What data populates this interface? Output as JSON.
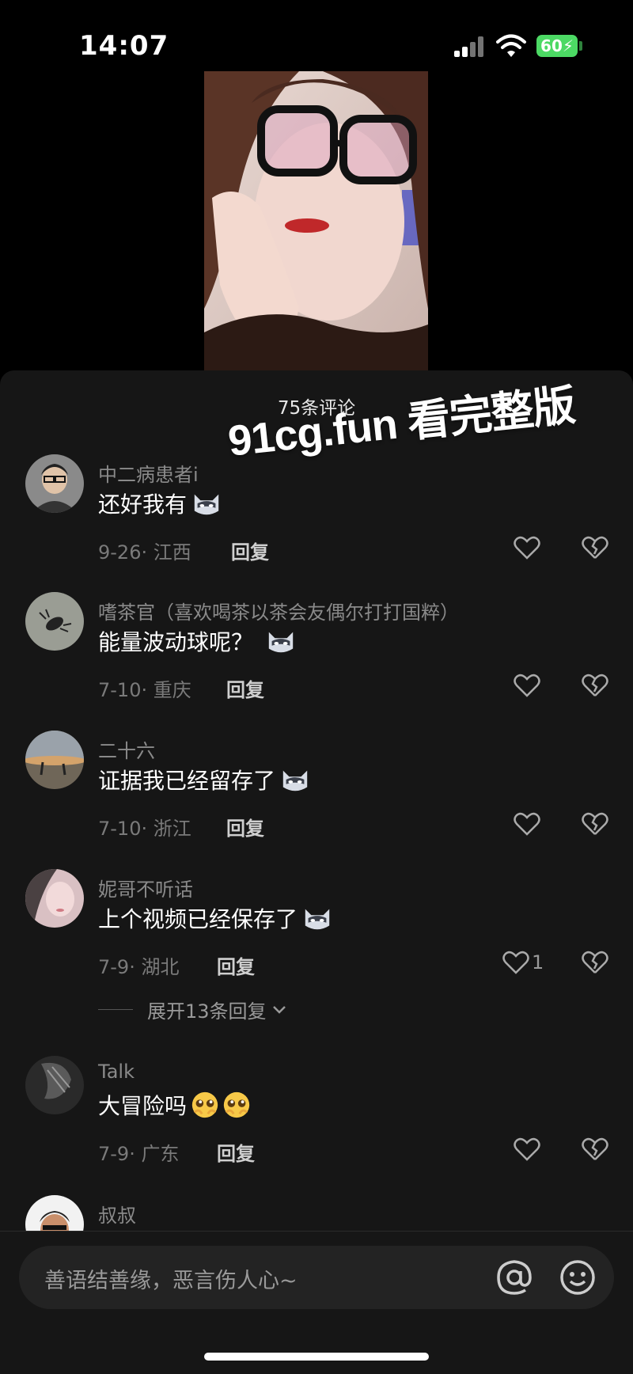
{
  "status_bar": {
    "time": "14:07",
    "battery": "60"
  },
  "sheet": {
    "title": "75条评论",
    "watermark": "91cg.fun 看完整版"
  },
  "comments": [
    {
      "name": "中二病患者i",
      "text": "还好我有",
      "date": "9-26",
      "location": "江西",
      "reply": "回复",
      "likes": ""
    },
    {
      "name": "嗜茶官（喜欢喝茶以茶会友偶尔打打国粹）",
      "text": "能量波动球呢？",
      "date": "7-10",
      "location": "重庆",
      "reply": "回复",
      "likes": ""
    },
    {
      "name": "二十六",
      "text": "证据我已经留存了",
      "date": "7-10",
      "location": "浙江",
      "reply": "回复",
      "likes": ""
    },
    {
      "name": "妮哥不听话",
      "text": "上个视频已经保存了",
      "date": "7-9",
      "location": "湖北",
      "reply": "回复",
      "likes": "1"
    },
    {
      "name": "Talk",
      "text": "大冒险吗",
      "date": "7-9",
      "location": "广东",
      "reply": "回复",
      "likes": ""
    },
    {
      "name": "叔叔"
    }
  ],
  "expand_replies": "展开13条回复",
  "input": {
    "placeholder": "善语结善缘，恶言伤人心~"
  },
  "icons": [
    "signal-icon",
    "wifi-icon",
    "heart-icon",
    "broken-heart-icon",
    "cat-emoji-icon",
    "pleading-emoji-icon",
    "at-icon",
    "smile-icon",
    "chevron-down-icon"
  ]
}
